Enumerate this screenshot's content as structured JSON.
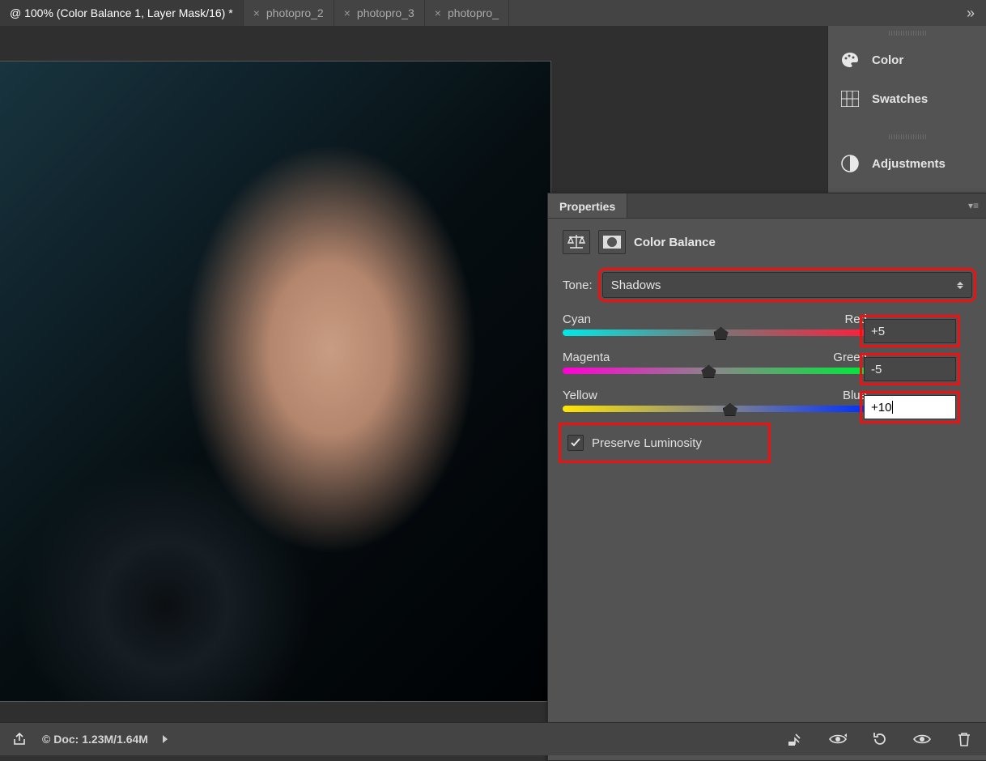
{
  "tabs": {
    "active_title": "@ 100% (Color Balance 1, Layer Mask/16) *",
    "others": [
      "photopro_2",
      "photopro_3",
      "photopro_"
    ],
    "more_glyph": "»"
  },
  "right_strip": {
    "items": [
      {
        "icon": "palette",
        "label": "Color"
      },
      {
        "icon": "swatches",
        "label": "Swatches"
      },
      {
        "icon": "adjustments",
        "label": "Adjustments"
      }
    ]
  },
  "properties": {
    "panel_title": "Properties",
    "adjustment_name": "Color Balance",
    "tone_label": "Tone:",
    "tone_value": "Shadows",
    "sliders": [
      {
        "left": "Cyan",
        "right": "Red",
        "value": "+5",
        "pos": 52,
        "track": "cr",
        "active": false
      },
      {
        "left": "Magenta",
        "right": "Green",
        "value": "-5",
        "pos": 48,
        "track": "mg",
        "active": false
      },
      {
        "left": "Yellow",
        "right": "Blue",
        "value": "+10",
        "pos": 55,
        "track": "yb",
        "active": true
      }
    ],
    "preserve_label": "Preserve Luminosity",
    "preserve_checked": true
  },
  "status": {
    "doc_label": "Doc:",
    "doc_size": "1.23M/1.64M"
  }
}
